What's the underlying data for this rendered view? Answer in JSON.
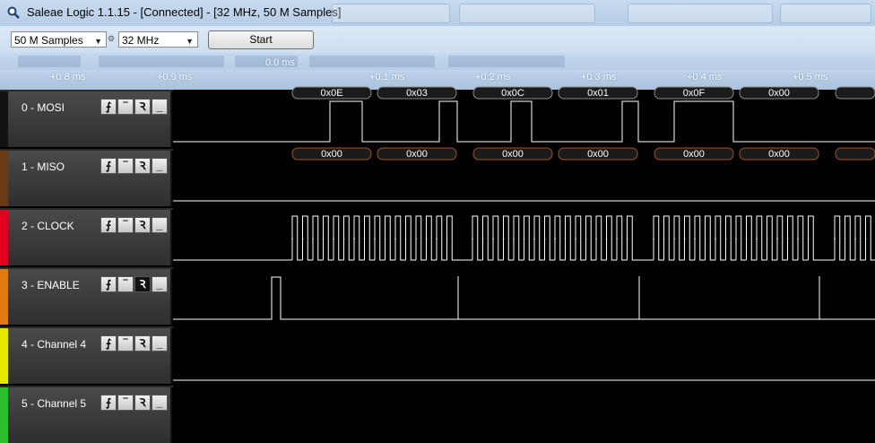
{
  "window": {
    "title": "Saleae Logic 1.1.15 - [Connected] - [32 MHz, 50 M Samples]"
  },
  "toolbar": {
    "samples_value": "50 M Samples",
    "rate_value": "32 MHz",
    "start_label": "Start"
  },
  "ruler": {
    "labels": [
      "+0.8 ms",
      "+0.9 ms",
      "0.0 ms",
      "+0.1 ms",
      "+0.2 ms",
      "+0.3 ms",
      "+0.4 ms",
      "+0.5 ms"
    ]
  },
  "channels": [
    {
      "label": "0 - MOSI",
      "color": "#111111"
    },
    {
      "label": "1 - MISO",
      "color": "#6b3a12"
    },
    {
      "label": "2 - CLOCK",
      "color": "#e0001b"
    },
    {
      "label": "3 - ENABLE",
      "color": "#e07a10"
    },
    {
      "label": "4 - Channel 4",
      "color": "#e6e600"
    },
    {
      "label": "5 - Channel 5",
      "color": "#2bc02b"
    }
  ],
  "decoded": {
    "mosi": [
      "0x0E",
      "0x03",
      "0x0C",
      "0x01",
      "0x0F",
      "0x00"
    ],
    "miso": [
      "0x00",
      "0x00",
      "0x00",
      "0x00",
      "0x00",
      "0x00"
    ]
  },
  "icons": {
    "app": "magnifier-icon",
    "rising_edge": "rising-edge-icon",
    "high": "high-level-icon",
    "falling_edge": "falling-edge-icon",
    "low": "low-level-icon"
  }
}
